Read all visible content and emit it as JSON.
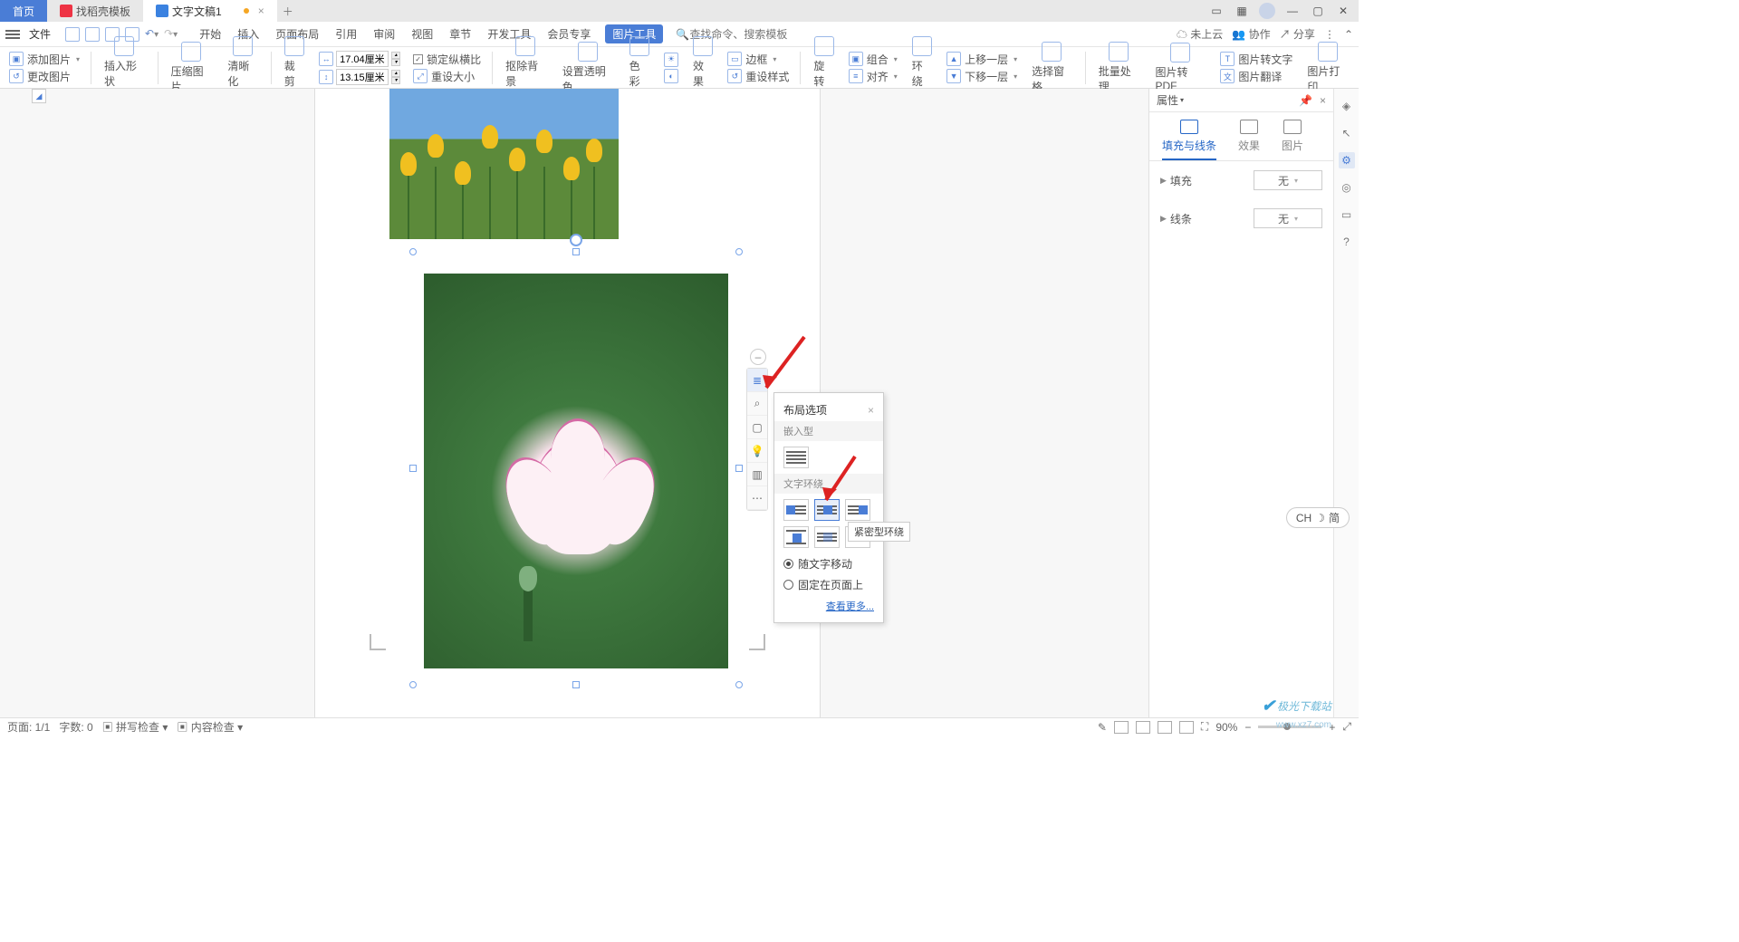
{
  "tabs": {
    "home": "首页",
    "t1": "找稻壳模板",
    "t2": "文字文稿1"
  },
  "menu": {
    "file": "文件",
    "items": [
      "开始",
      "插入",
      "页面布局",
      "引用",
      "审阅",
      "视图",
      "章节",
      "开发工具",
      "会员专享"
    ],
    "context": "图片工具",
    "search_placeholder": "查找命令、搜索模板"
  },
  "topRight": {
    "cloud": "未上云",
    "coop": "协作",
    "share": "分享"
  },
  "ribbon": {
    "addImage": "添加图片",
    "changeImage": "更改图片",
    "insertShape": "插入形状",
    "compress": "压缩图片",
    "sharpen": "清晰化",
    "crop": "裁剪",
    "width": "17.04厘米",
    "height": "13.15厘米",
    "lockRatio": "锁定纵横比",
    "resetSize": "重设大小",
    "removeBg": "抠除背景",
    "transparency": "设置透明色",
    "colorFx": "色彩",
    "effects": "效果",
    "border": "边框",
    "resetStyle": "重设样式",
    "rotate": "旋转",
    "align": "对齐",
    "group": "组合",
    "wrap": "环绕",
    "up1": "上移一层",
    "down1": "下移一层",
    "selPane": "选择窗格",
    "batch": "批量处理",
    "toPdf": "图片转PDF",
    "toText": "图片转文字",
    "translate": "图片翻译",
    "print": "图片打印"
  },
  "popup": {
    "title": "布局选项",
    "sec1": "嵌入型",
    "sec2": "文字环绕",
    "tooltip": "紧密型环绕",
    "opt1": "随文字移动",
    "opt2": "固定在页面上",
    "more": "查看更多..."
  },
  "sidepanel": {
    "title": "属性",
    "tab1": "填充与线条",
    "tab2": "效果",
    "tab3": "图片",
    "fill": "填充",
    "line": "线条",
    "none": "无"
  },
  "status": {
    "page": "页面: 1/1",
    "words": "字数: 0",
    "spell": "拼写检查",
    "content": "内容检查",
    "zoom": "90%"
  },
  "ime": {
    "lang": "CH",
    "mode": "简"
  },
  "watermark": {
    "text": "极光下载站",
    "url": "www.xz7.com"
  }
}
